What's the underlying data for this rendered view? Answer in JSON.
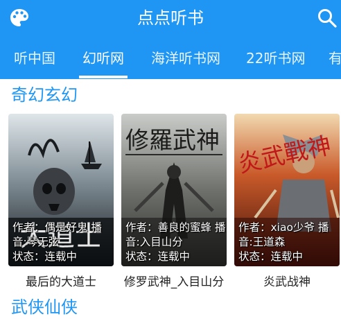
{
  "app": {
    "title": "点点听书"
  },
  "icons": {
    "menu": "palette-icon",
    "search": "search-icon"
  },
  "colors": {
    "primary": "#1f96f3",
    "section_title": "#1f96f3"
  },
  "tabs": [
    {
      "label": "听中国",
      "active": false
    },
    {
      "label": "幻听网",
      "active": true
    },
    {
      "label": "海洋听书网",
      "active": false
    },
    {
      "label": "22听书网",
      "active": false
    },
    {
      "label": "有",
      "active": false
    }
  ],
  "sections": [
    {
      "title": "奇幻玄幻",
      "books": [
        {
          "title": "最后的大道士",
          "author": "作者：偶是好鬼 播音:琴无弦",
          "status": "状态：连载中",
          "cover_text": "大道士"
        },
        {
          "title": "修罗武神_入目山分",
          "author": "作者：善良的蜜蜂 播音:入目山分",
          "status": "状态：连载中",
          "cover_text": "修羅武神"
        },
        {
          "title": "炎武战神",
          "author": "作者：xiao少爷 播音:王道森",
          "status": "状态：连载中",
          "cover_text": "炎武戰神"
        }
      ]
    },
    {
      "title": "武侠仙侠",
      "books": []
    }
  ]
}
